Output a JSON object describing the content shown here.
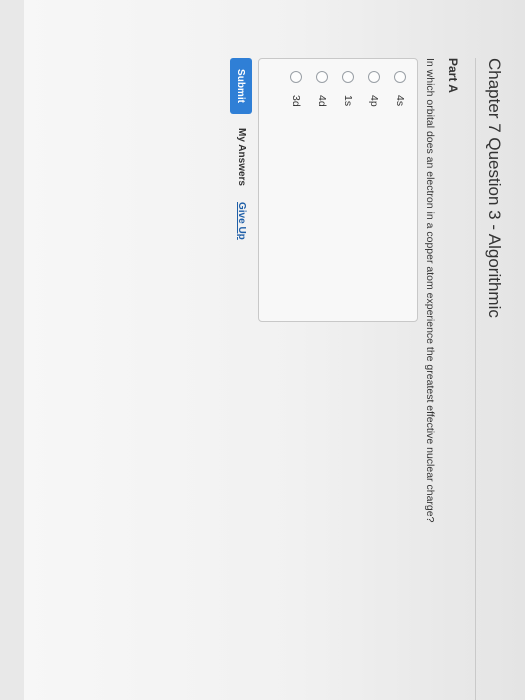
{
  "page": {
    "title": "Chapter 7 Question 3 - Algorithmic"
  },
  "part": {
    "label": "Part A"
  },
  "question": {
    "text": "In which orbital does an electron in a copper atom experience the greatest effective nuclear charge?"
  },
  "options": [
    {
      "label": "4s",
      "selected": false
    },
    {
      "label": "4p",
      "selected": false
    },
    {
      "label": "1s",
      "selected": false
    },
    {
      "label": "4d",
      "selected": false
    },
    {
      "label": "3d",
      "selected": false
    }
  ],
  "actions": {
    "submit_label": "Submit",
    "my_answers_label": "My Answers",
    "give_up_label": "Give Up"
  },
  "colors": {
    "submit_background": "#2f7fd6",
    "link": "#1f5fa8"
  },
  "icons": {
    "cursor": "mouse-pointer-icon"
  }
}
